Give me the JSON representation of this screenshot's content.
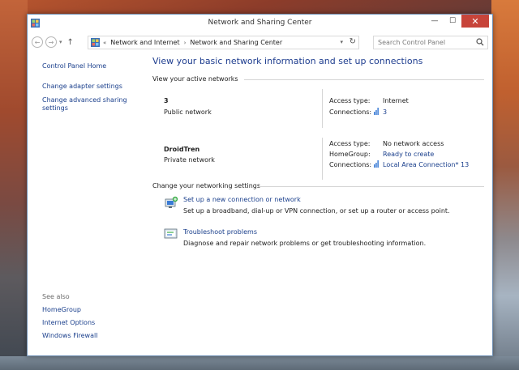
{
  "window": {
    "title": "Network and Sharing Center"
  },
  "titlebar": {
    "minimize_glyph": "—",
    "maximize_glyph": "☐",
    "close_glyph": "✕"
  },
  "nav": {
    "back_glyph": "←",
    "forward_glyph": "→",
    "up_glyph": "↑",
    "breadcrumb": {
      "prefix": "«",
      "items": [
        "Network and Internet",
        "Network and Sharing Center"
      ],
      "separator": "›"
    },
    "search_placeholder": "Search Control Panel"
  },
  "sidebar": {
    "home": "Control Panel Home",
    "links": [
      "Change adapter settings",
      "Change advanced sharing settings"
    ],
    "see_also_heading": "See also",
    "see_also": [
      "HomeGroup",
      "Internet Options",
      "Windows Firewall"
    ]
  },
  "main": {
    "heading": "View your basic network information and set up connections",
    "active_networks_heading": "View your active networks",
    "networks": [
      {
        "name": "3",
        "category": "Public network",
        "access_type_label": "Access type:",
        "access_type": "Internet",
        "connections_label": "Connections:",
        "connection": "3"
      },
      {
        "name": "DroidTren",
        "category": "Private network",
        "access_type_label": "Access type:",
        "access_type": "No network access",
        "homegroup_label": "HomeGroup:",
        "homegroup": "Ready to create",
        "connections_label": "Connections:",
        "connection": "Local Area Connection* 13"
      }
    ],
    "settings_heading": "Change your networking settings",
    "tasks": [
      {
        "title": "Set up a new connection or network",
        "desc": "Set up a broadband, dial-up or VPN connection, or set up a router or access point.",
        "icon": "new-connection-icon"
      },
      {
        "title": "Troubleshoot problems",
        "desc": "Diagnose and repair network problems or get troubleshooting information.",
        "icon": "troubleshoot-icon"
      }
    ]
  },
  "colors": {
    "link": "#1a3f8c",
    "heading": "#1e3d8f",
    "close_button": "#c7443a"
  }
}
